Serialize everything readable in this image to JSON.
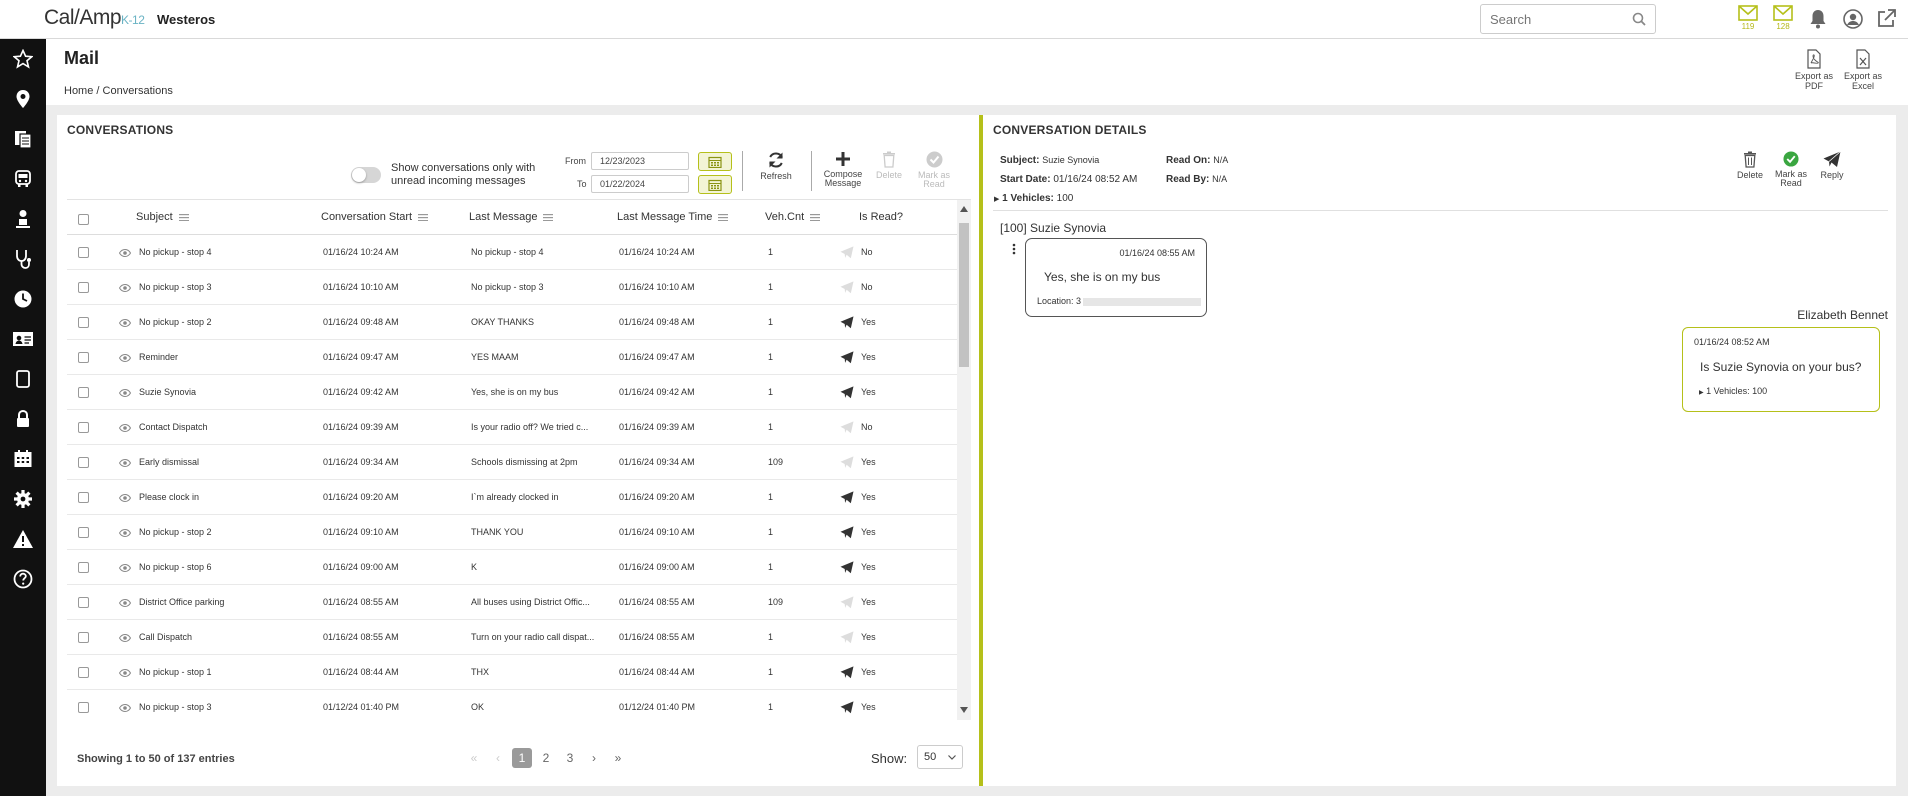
{
  "app": {
    "logo_main": "Cal/Amp",
    "logo_sub": "K-12",
    "tenant": "Westeros"
  },
  "search": {
    "placeholder": "Search"
  },
  "topbar": {
    "mail_count_1": "119",
    "mail_count_2": "128"
  },
  "page": {
    "title": "Mail",
    "breadcrumb": "Home / Conversations",
    "export_pdf": "Export as PDF",
    "export_excel": "Export as Excel"
  },
  "conversations": {
    "title": "CONVERSATIONS",
    "toggle_label": "Show conversations only with unread incoming messages",
    "from_label": "From",
    "from_value": "12/23/2023",
    "to_label": "To",
    "to_value": "01/22/2024",
    "refresh": "Refresh",
    "compose": "Compose Message",
    "delete": "Delete",
    "mark_read": "Mark as Read",
    "columns": [
      "Subject",
      "Conversation Start",
      "Last Message",
      "Last Message Time",
      "Veh.Cnt",
      "Is Read?"
    ],
    "rows": [
      {
        "subject": "No pickup - stop 4",
        "start": "01/16/24 10:24 AM",
        "last": "No pickup - stop 4",
        "time": "01/16/24 10:24 AM",
        "veh": "1",
        "read": "No",
        "sent": false
      },
      {
        "subject": "No pickup - stop 3",
        "start": "01/16/24 10:10 AM",
        "last": "No pickup - stop 3",
        "time": "01/16/24 10:10 AM",
        "veh": "1",
        "read": "No",
        "sent": false
      },
      {
        "subject": "No pickup - stop 2",
        "start": "01/16/24 09:48 AM",
        "last": "OKAY THANKS",
        "time": "01/16/24 09:48 AM",
        "veh": "1",
        "read": "Yes",
        "sent": true
      },
      {
        "subject": "Reminder",
        "start": "01/16/24 09:47 AM",
        "last": " YES MAAM",
        "time": "01/16/24 09:47 AM",
        "veh": "1",
        "read": "Yes",
        "sent": true
      },
      {
        "subject": "Suzie Synovia",
        "start": "01/16/24 09:42 AM",
        "last": " Yes, she is on my bus",
        "time": "01/16/24 09:42 AM",
        "veh": "1",
        "read": "Yes",
        "sent": true
      },
      {
        "subject": "Contact Dispatch",
        "start": "01/16/24 09:39 AM",
        "last": "Is your radio off? We tried c...",
        "time": "01/16/24 09:39 AM",
        "veh": "1",
        "read": "No",
        "sent": false
      },
      {
        "subject": "Early dismissal",
        "start": "01/16/24 09:34 AM",
        "last": "Schools dismissing at 2pm",
        "time": "01/16/24 09:34 AM",
        "veh": "109",
        "read": "Yes",
        "sent": false
      },
      {
        "subject": "Please clock in",
        "start": "01/16/24 09:20 AM",
        "last": " I`m already clocked in",
        "time": "01/16/24 09:20 AM",
        "veh": "1",
        "read": "Yes",
        "sent": true
      },
      {
        "subject": "No pickup - stop 2",
        "start": "01/16/24 09:10 AM",
        "last": "THANK YOU",
        "time": "01/16/24 09:10 AM",
        "veh": "1",
        "read": "Yes",
        "sent": true
      },
      {
        "subject": "No pickup - stop 6",
        "start": "01/16/24 09:00 AM",
        "last": "K",
        "time": "01/16/24 09:00 AM",
        "veh": "1",
        "read": "Yes",
        "sent": true
      },
      {
        "subject": "District Office parking",
        "start": "01/16/24 08:55 AM",
        "last": " All buses using District Offic...",
        "time": "01/16/24 08:55 AM",
        "veh": "109",
        "read": "Yes",
        "sent": false
      },
      {
        "subject": "Call Dispatch",
        "start": "01/16/24 08:55 AM",
        "last": "Turn on your radio call dispat...",
        "time": "01/16/24 08:55 AM",
        "veh": "1",
        "read": "Yes",
        "sent": false
      },
      {
        "subject": "No pickup - stop 1",
        "start": "01/16/24 08:44 AM",
        "last": " THX",
        "time": "01/16/24 08:44 AM",
        "veh": "1",
        "read": "Yes",
        "sent": true
      },
      {
        "subject": "No pickup - stop 3",
        "start": "01/12/24 01:40 PM",
        "last": " OK",
        "time": "01/12/24 01:40 PM",
        "veh": "1",
        "read": "Yes",
        "sent": true
      }
    ],
    "footer": "Showing 1 to 50 of 137 entries",
    "pages": [
      "1",
      "2",
      "3"
    ],
    "show_label": "Show:",
    "show_value": "50"
  },
  "details": {
    "title": "CONVERSATION DETAILS",
    "subject_label": "Subject:",
    "subject": "Suzie Synovia",
    "start_label": "Start Date:",
    "start": "01/16/24 08:52 AM",
    "read_on_label": "Read On:",
    "read_on": "N/A",
    "read_by_label": "Read By:",
    "read_by": "N/A",
    "vehicles": "1 Vehicles:",
    "vehicles_value": "100",
    "delete": "Delete",
    "mark_read": "Mark as Read",
    "reply": "Reply",
    "sender_heading": "[100] Suzie Synovia",
    "incoming": {
      "time": "01/16/24 08:55 AM",
      "text": "Yes, she is on my bus",
      "location_label": "Location: 3"
    },
    "outgoing": {
      "author": "Elizabeth Bennet",
      "time": "01/16/24 08:52 AM",
      "text": "Is Suzie Synovia on your bus?",
      "vehicles": "1 Vehicles: 100"
    }
  },
  "colors": {
    "accent": "#b5c01a",
    "sidebar": "#111111"
  }
}
